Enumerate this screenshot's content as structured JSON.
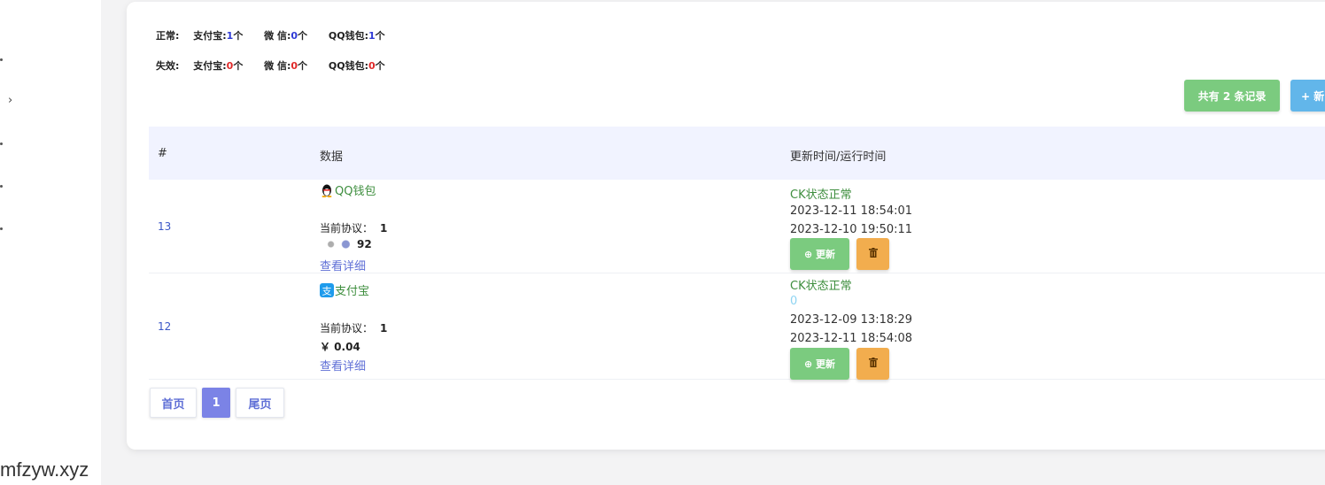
{
  "watermark": "mfzyw.xyz",
  "stats": {
    "normal": {
      "label": "正常:",
      "items": [
        {
          "name": "支付宝:",
          "count": "1",
          "unit": "个"
        },
        {
          "name": "微 信:",
          "count": "0",
          "unit": "个"
        },
        {
          "name": "QQ钱包:",
          "count": "1",
          "unit": "个"
        }
      ]
    },
    "invalid": {
      "label": "失效:",
      "items": [
        {
          "name": "支付宝:",
          "count": "0",
          "unit": "个"
        },
        {
          "name": "微 信:",
          "count": "0",
          "unit": "个"
        },
        {
          "name": "QQ钱包:",
          "count": "0",
          "unit": "个"
        }
      ]
    }
  },
  "toolbar": {
    "total_label": "共有 2 条记录",
    "new_label": "+ 新"
  },
  "table": {
    "headers": {
      "id": "#",
      "data": "数据",
      "time": "更新时间/运行时间"
    },
    "rows": [
      {
        "id": "13",
        "type": "QQ钱包",
        "protocol_label": "当前协议：",
        "protocol_value": "1",
        "amount": "92",
        "detail": "查看详细",
        "status": "CK状态正常",
        "extra": "",
        "time1": "2023-12-11 18:54:01",
        "time2": "2023-12-10 19:50:11",
        "update_label": "⊕ 更新",
        "delete_icon": "trash-icon"
      },
      {
        "id": "12",
        "type": "支付宝",
        "protocol_label": "当前协议：",
        "protocol_value": "1",
        "amount": "￥ 0.04",
        "detail": "查看详细",
        "status": "CK状态正常",
        "extra": "0",
        "time1": "2023-12-09 13:18:29",
        "time2": "2023-12-11 18:54:08",
        "update_label": "⊕ 更新",
        "delete_icon": "trash-icon"
      }
    ]
  },
  "pagination": {
    "first": "首页",
    "current": "1",
    "last": "尾页"
  },
  "colors": {
    "accent_green": "#7bcb7f",
    "accent_blue": "#62b6ea",
    "warning": "#f2ad4e",
    "page_active": "#7b83e6"
  }
}
